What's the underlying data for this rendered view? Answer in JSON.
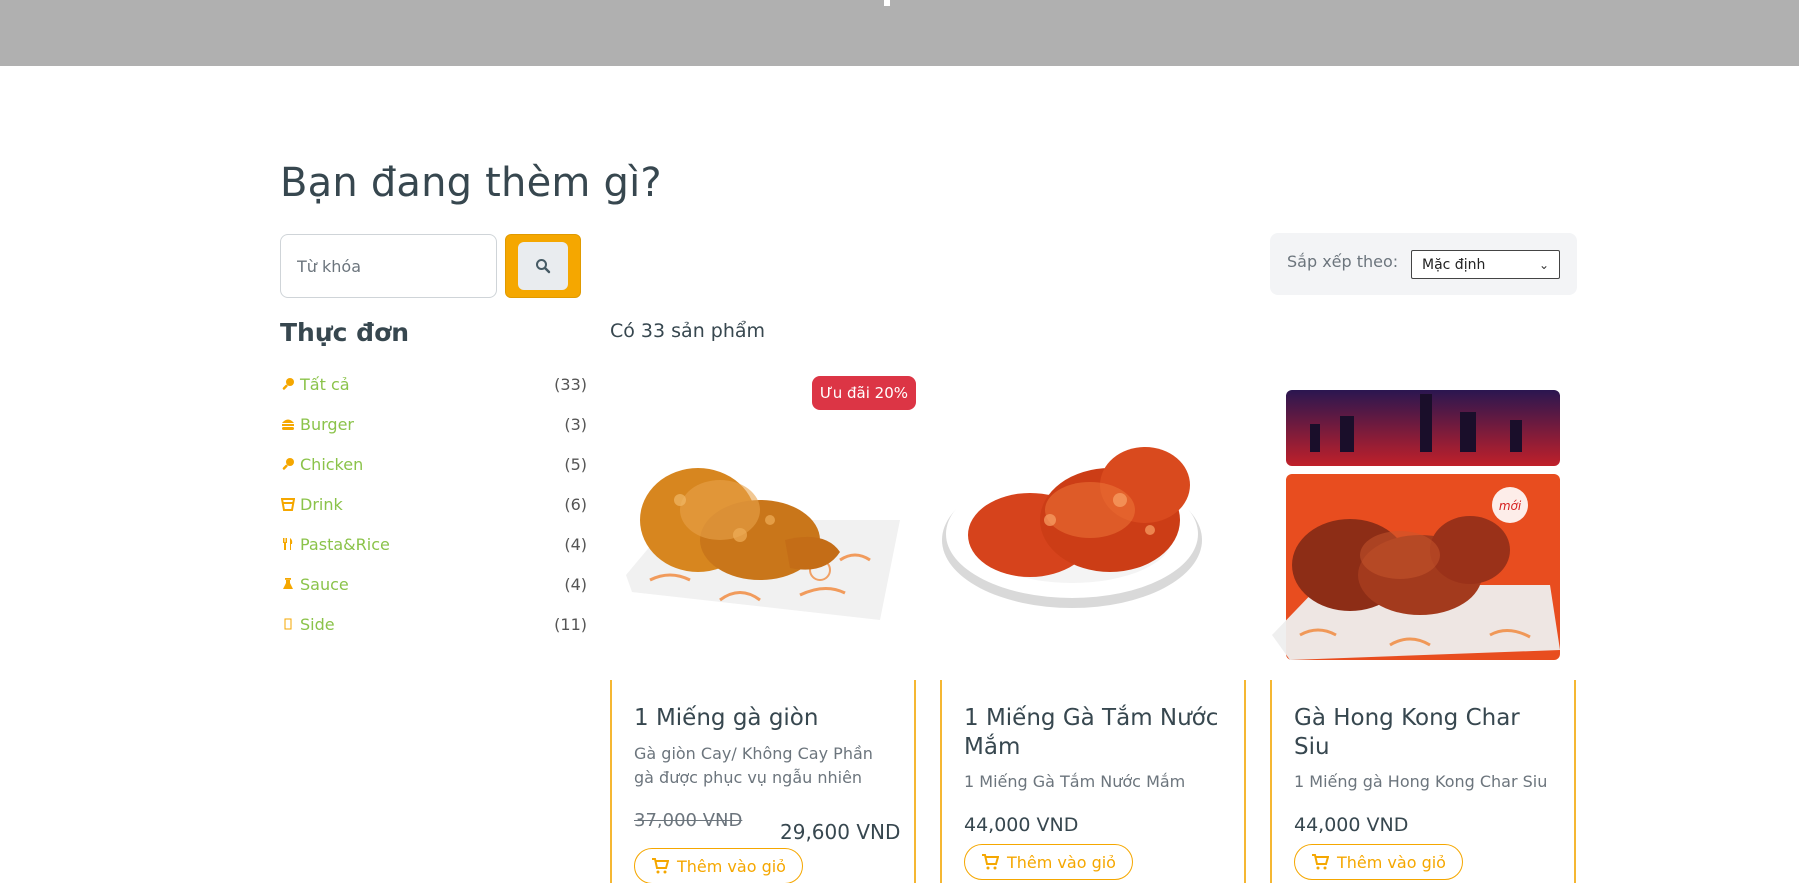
{
  "title": "Bạn đang thèm gì?",
  "search": {
    "placeholder": "Từ khóa"
  },
  "icons": {
    "search": "search-icon",
    "cart": "cart-icon"
  },
  "colors": {
    "accent": "#f5a700",
    "category_link": "#8bc34a",
    "badge": "#dc3545"
  },
  "sort": {
    "label": "Sắp xếp theo:",
    "selected": "Mặc định"
  },
  "menu": {
    "title": "Thực đơn",
    "items": [
      {
        "label": "Tất cả",
        "count": "(33)",
        "icon": "drumstick-icon"
      },
      {
        "label": "Burger",
        "count": "(3)",
        "icon": "burger-icon"
      },
      {
        "label": "Chicken",
        "count": "(5)",
        "icon": "drumstick-icon"
      },
      {
        "label": "Drink",
        "count": "(6)",
        "icon": "glass-icon"
      },
      {
        "label": "Pasta&Rice",
        "count": "(4)",
        "icon": "utensils-icon"
      },
      {
        "label": "Sauce",
        "count": "(4)",
        "icon": "flask-icon"
      },
      {
        "label": "Side",
        "count": "(11)",
        "icon": "box-icon"
      }
    ]
  },
  "product_count": "Có 33 sản phẩm",
  "products": [
    {
      "name": "1 Miếng gà giòn",
      "description": "Gà giòn Cay/ Không Cay Phần gà được phục vụ ngẫu nhiên",
      "badge": "Ưu đãi 20%",
      "old_price": "37,000 VND",
      "price": "29,600 VND",
      "button": "Thêm vào giỏ"
    },
    {
      "name": "1 Miếng Gà Tắm Nước Mắm",
      "description": "1 Miếng Gà Tắm Nước Mắm",
      "price": "44,000 VND",
      "button": "Thêm vào giỏ"
    },
    {
      "name": "Gà Hong Kong Char Siu",
      "description": "1 Miếng gà Hong Kong Char Siu",
      "badge_text": "mới",
      "price": "44,000 VND",
      "button": "Thêm vào giỏ"
    }
  ]
}
